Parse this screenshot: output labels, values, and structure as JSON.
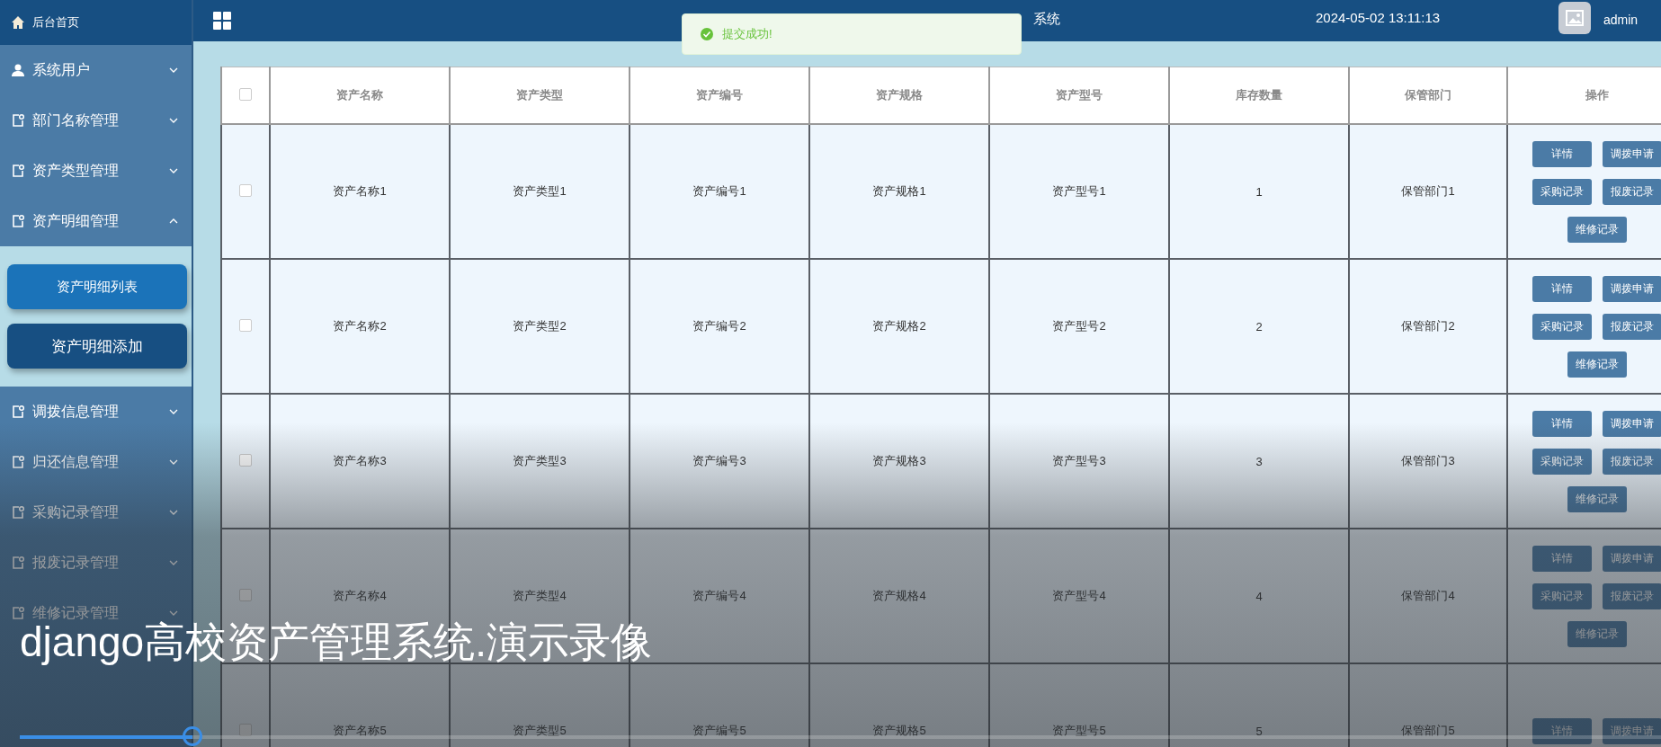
{
  "sidebar": {
    "home": "后台首页",
    "items": [
      {
        "label": "系统用户",
        "kind": "user",
        "expanded": false
      },
      {
        "label": "部门名称管理",
        "kind": "module",
        "expanded": false
      },
      {
        "label": "资产类型管理",
        "kind": "module",
        "expanded": false
      },
      {
        "label": "资产明细管理",
        "kind": "module",
        "expanded": true,
        "children": [
          {
            "label": "资产明细列表",
            "selected": false
          },
          {
            "label": "资产明细添加",
            "selected": true
          }
        ]
      },
      {
        "label": "调拨信息管理",
        "kind": "module",
        "expanded": false
      },
      {
        "label": "归还信息管理",
        "kind": "module",
        "expanded": false
      },
      {
        "label": "采购记录管理",
        "kind": "module",
        "expanded": false
      },
      {
        "label": "报废记录管理",
        "kind": "module",
        "expanded": false
      },
      {
        "label": "维修记录管理",
        "kind": "module",
        "expanded": false
      }
    ]
  },
  "header": {
    "title": "系统",
    "datetime": "2024-05-02 13:11:13",
    "user": "admin"
  },
  "toast": {
    "message": "提交成功!"
  },
  "table": {
    "header_checked": false,
    "columns": [
      "资产名称",
      "资产类型",
      "资产编号",
      "资产规格",
      "资产型号",
      "库存数量",
      "保管部门",
      "操作"
    ],
    "rows": [
      {
        "checked": false,
        "cells": [
          "资产名称1",
          "资产类型1",
          "资产编号1",
          "资产规格1",
          "资产型号1",
          "1",
          "保管部门1"
        ],
        "actions": [
          "详情",
          "调拨申请",
          "采购记录",
          "报废记录",
          "维修记录"
        ]
      },
      {
        "checked": false,
        "cells": [
          "资产名称2",
          "资产类型2",
          "资产编号2",
          "资产规格2",
          "资产型号2",
          "2",
          "保管部门2"
        ],
        "actions": [
          "详情",
          "调拨申请",
          "采购记录",
          "报废记录",
          "维修记录"
        ]
      },
      {
        "checked": false,
        "cells": [
          "资产名称3",
          "资产类型3",
          "资产编号3",
          "资产规格3",
          "资产型号3",
          "3",
          "保管部门3"
        ],
        "actions": [
          "详情",
          "调拨申请",
          "采购记录",
          "报废记录",
          "维修记录"
        ]
      },
      {
        "checked": false,
        "cells": [
          "资产名称4",
          "资产类型4",
          "资产编号4",
          "资产规格4",
          "资产型号4",
          "4",
          "保管部门4"
        ],
        "actions": [
          "详情",
          "调拨申请",
          "采购记录",
          "报废记录",
          "维修记录"
        ]
      },
      {
        "checked": false,
        "cells": [
          "资产名称5",
          "资产类型5",
          "资产编号5",
          "资产规格5",
          "资产型号5",
          "5",
          "保管部门5"
        ],
        "actions": [
          "详情",
          "调拨申请"
        ]
      }
    ]
  },
  "video": {
    "caption": "django高校资产管理系统.演示录像",
    "progress": {
      "level": 0.105
    }
  }
}
